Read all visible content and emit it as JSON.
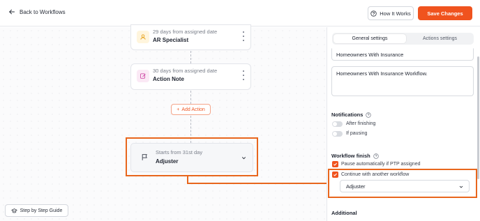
{
  "header": {
    "back_label": "Back to Workflows",
    "how_label": "How It Works",
    "save_label": "Save Changes"
  },
  "canvas": {
    "nodes": [
      {
        "subtitle": "29 days from assigned date",
        "title": "AR Specialist",
        "icon": "user-icon"
      },
      {
        "subtitle": "30 days from assigned date",
        "title": "Action Note",
        "icon": "edit-icon"
      }
    ],
    "add_action_label": "Add Action",
    "trigger": {
      "subtitle": "Starts from 31st day",
      "title": "Adjuster",
      "icon": "flag-icon"
    },
    "guide_label": "Step by Step Guide"
  },
  "panel": {
    "tabs": [
      {
        "label": "General settings",
        "active": true
      },
      {
        "label": "Actions settings",
        "active": false
      }
    ],
    "name_value": "Homeowners With Insurance",
    "description_value": "Homeowners With Insurance Workflow.",
    "notifications": {
      "title": "Notifications",
      "toggles": [
        "After finishing",
        "If pausing"
      ]
    },
    "finish": {
      "title": "Workflow finish",
      "options": [
        "Pause automatically if PTP assigned",
        "Continue with another workflow"
      ],
      "workflow_select": "Adjuster"
    },
    "additional_title": "Additional"
  },
  "colors": {
    "accent": "#f0531e",
    "highlight": "#e8661d"
  }
}
